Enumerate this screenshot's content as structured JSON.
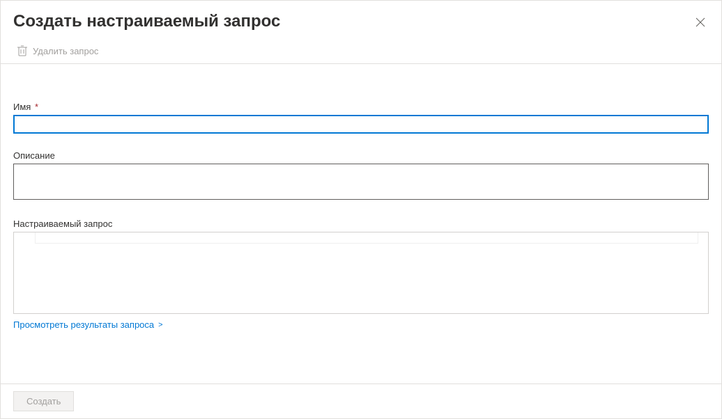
{
  "header": {
    "title": "Создать настраиваемый запрос"
  },
  "toolbar": {
    "delete_label": "Удалить запрос"
  },
  "form": {
    "name_label": "Имя",
    "required_mark": "*",
    "name_value": "",
    "description_label": "Описание",
    "description_value": "",
    "query_label": "Настраиваемый запрос",
    "view_results_label": "Просмотреть результаты запроса",
    "view_results_chevron": ">"
  },
  "footer": {
    "create_label": "Создать"
  }
}
